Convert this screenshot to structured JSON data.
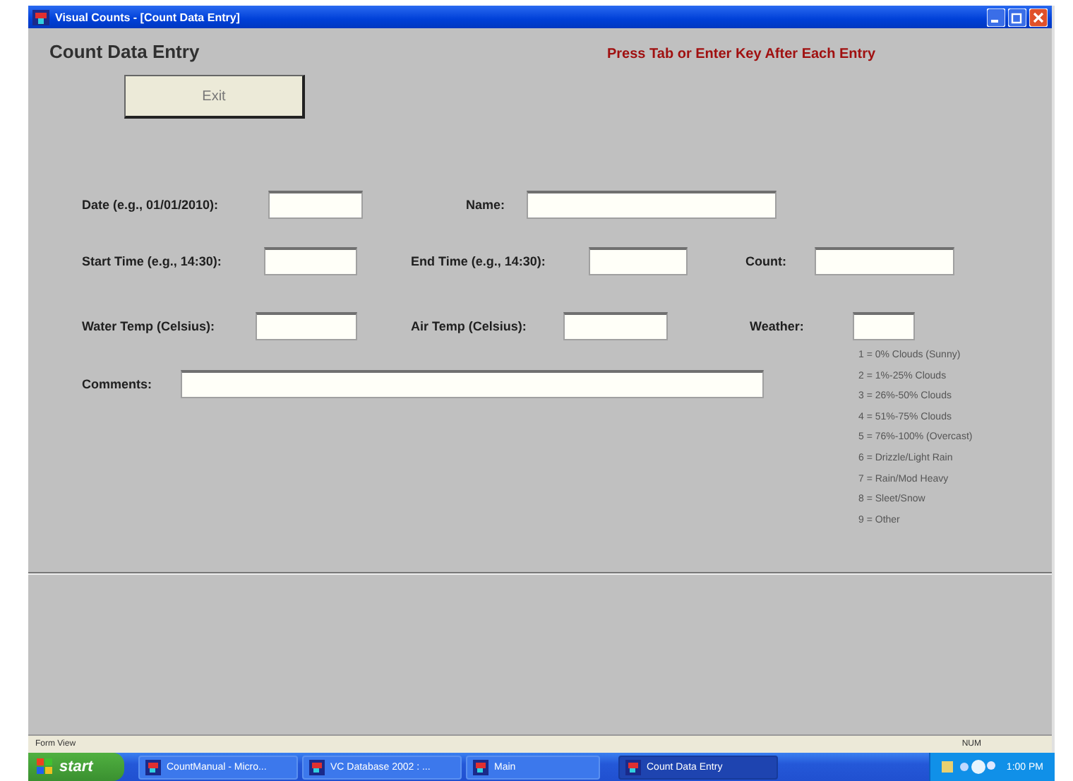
{
  "window": {
    "title": "Visual Counts - [Count Data Entry]"
  },
  "form": {
    "title": "Count Data Entry",
    "instruction": "Press Tab or Enter Key After Each Entry",
    "exit_button": "Exit",
    "rows": [
      [
        {
          "label": "Date (e.g., 01/01/2010):"
        },
        {
          "label": "Name:"
        }
      ],
      [
        {
          "label": "Start Time (e.g., 14:30):"
        },
        {
          "label": "End Time (e.g., 14:30):"
        },
        {
          "label": "Count:"
        }
      ],
      [
        {
          "label": "Water Temp (Celsius):"
        },
        {
          "label": "Air Temp (Celsius):"
        },
        {
          "label": "Weather:"
        }
      ]
    ],
    "comments": {
      "label": "Comments:"
    },
    "weather_legend": [
      "1 = 0% Clouds (Sunny)",
      "2 = 1%-25% Clouds",
      "3 = 26%-50% Clouds",
      "4 = 51%-75% Clouds",
      "5 = 76%-100% (Overcast)",
      "6 = Drizzle/Light Rain",
      "7 = Rain/Mod Heavy",
      "8 = Sleet/Snow",
      "9 = Other"
    ]
  },
  "status_bar": {
    "left": "Form View",
    "right": "NUM"
  },
  "taskbar": {
    "start": "start",
    "tasks": [
      {
        "label": "CountManual - Micro...",
        "selected": false
      },
      {
        "label": "VC Database 2002 : ...",
        "selected": false
      },
      {
        "label": "Main",
        "selected": false
      },
      {
        "label": "Count Data Entry",
        "selected": true
      }
    ],
    "clock": "1:00 PM"
  }
}
